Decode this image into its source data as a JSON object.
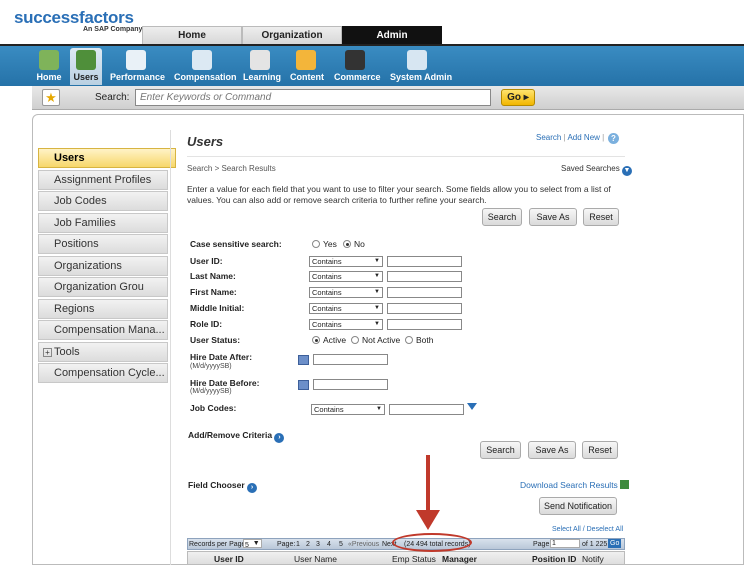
{
  "brand": {
    "name": "successfactors",
    "tagline": "An SAP Company"
  },
  "top_tabs": [
    "Home",
    "Organization",
    "Admin"
  ],
  "nav": [
    {
      "label": "Home",
      "icon": "home-icon"
    },
    {
      "label": "Users",
      "icon": "users-icon"
    },
    {
      "label": "Performance",
      "icon": "performance-icon"
    },
    {
      "label": "Compensation",
      "icon": "compensation-icon"
    },
    {
      "label": "Learning",
      "icon": "learning-icon"
    },
    {
      "label": "Content",
      "icon": "content-icon"
    },
    {
      "label": "Commerce",
      "icon": "commerce-icon"
    },
    {
      "label": "System Admin",
      "icon": "system-admin-icon"
    }
  ],
  "search": {
    "label": "Search:",
    "placeholder": "Enter Keywords or Command",
    "go": "Go"
  },
  "sidebar": [
    "Users",
    "Assignment Profiles",
    "Job Codes",
    "Job Families",
    "Positions",
    "Organizations",
    "Organization Grou",
    "Regions",
    "Compensation Mana...",
    "Tools",
    "Compensation Cycle..."
  ],
  "page": {
    "title": "Users",
    "links": {
      "search": "Search",
      "add_new": "Add New"
    },
    "breadcrumb": "Search > Search Results",
    "saved_searches": "Saved Searches",
    "intro": "Enter a value for each field that you want to use to filter your search. Some fields allow you to select from a list of values. You can also add or remove search criteria to further refine your search."
  },
  "buttons": {
    "search": "Search",
    "save_as": "Save As",
    "reset": "Reset",
    "send_notification": "Send Notification"
  },
  "form": {
    "case_sensitive": {
      "label": "Case sensitive search:",
      "yes": "Yes",
      "no": "No",
      "selected": "No"
    },
    "fields": [
      {
        "label": "User ID:",
        "op": "Contains"
      },
      {
        "label": "Last Name:",
        "op": "Contains"
      },
      {
        "label": "First Name:",
        "op": "Contains"
      },
      {
        "label": "Middle Initial:",
        "op": "Contains"
      },
      {
        "label": "Role ID:",
        "op": "Contains"
      }
    ],
    "user_status": {
      "label": "User Status:",
      "options": [
        "Active",
        "Not Active",
        "Both"
      ],
      "selected": "Active"
    },
    "hire_after": {
      "label": "Hire Date After:",
      "format": "(M/d/yyyySB)"
    },
    "hire_before": {
      "label": "Hire Date Before:",
      "format": "(M/d/yyyySB)"
    },
    "job_codes": {
      "label": "Job Codes:",
      "op": "Contains"
    },
    "add_remove": "Add/Remove Criteria"
  },
  "results": {
    "field_chooser": "Field Chooser",
    "download": "Download Search Results",
    "select_all": "Select All / Deselect All",
    "pager": {
      "records_per_page": "Records per Page",
      "per_page_value": "5",
      "page_label": "Page:",
      "pages": [
        "1",
        "2",
        "3",
        "4",
        "5"
      ],
      "prev": "«Previous",
      "next": "Next",
      "total": "(24 494 total records)",
      "page_right": "Page",
      "current": "1",
      "of": "of 1 225",
      "go": "Go"
    },
    "columns": [
      "User ID",
      "User Name",
      "Emp Status",
      "Manager",
      "Position ID",
      "Notify"
    ]
  },
  "colors": {
    "brand_blue": "#2a6fb6",
    "nav_blue": "#2f7fb8",
    "annotation_red": "#c0392b",
    "active_yellow": "#f7d76a"
  }
}
